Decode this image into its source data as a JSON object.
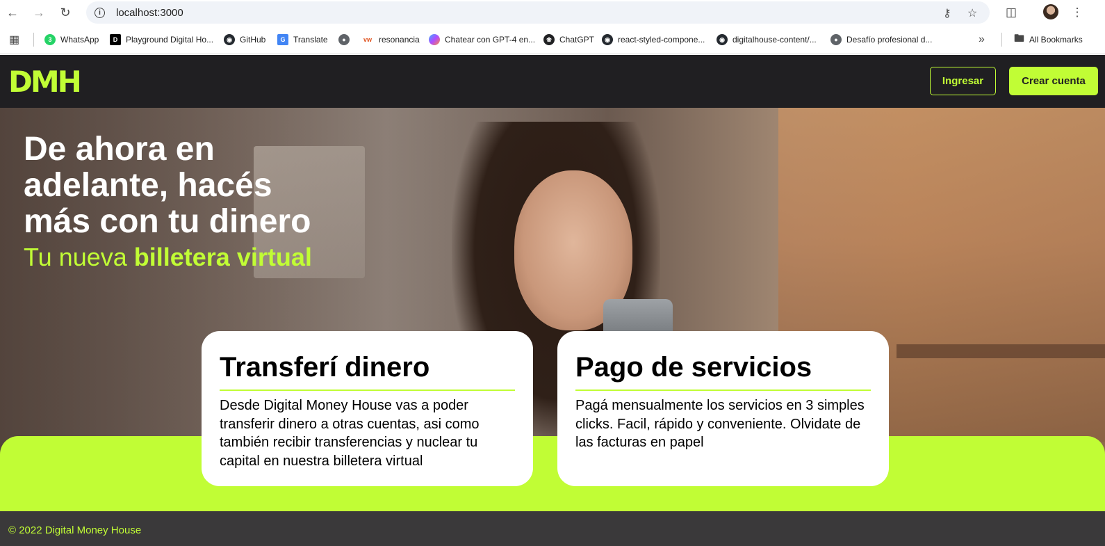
{
  "browser": {
    "url": "localhost:3000",
    "bookmarks": [
      {
        "label": "WhatsApp",
        "icon": "whatsapp-icon",
        "color": "#25d366"
      },
      {
        "label": "Playground Digital Ho...",
        "icon": "digital-house-icon",
        "color": "#000000"
      },
      {
        "label": "GitHub",
        "icon": "github-icon",
        "color": "#24292f"
      },
      {
        "label": "Translate",
        "icon": "google-translate-icon",
        "color": "#4285f4"
      },
      {
        "label": "",
        "icon": "globe-icon",
        "color": "#5f6368"
      },
      {
        "label": "resonancia",
        "icon": "resonancia-icon",
        "color": "#e0531f"
      },
      {
        "label": "Chatear con GPT-4 en...",
        "icon": "copilot-icon",
        "color": "#8a5cf6"
      },
      {
        "label": "ChatGPT",
        "icon": "openai-icon",
        "color": "#202123"
      },
      {
        "label": "react-styled-compone...",
        "icon": "github-icon",
        "color": "#24292f"
      },
      {
        "label": "digitalhouse-content/...",
        "icon": "github-icon",
        "color": "#24292f"
      },
      {
        "label": "Desafío profesional d...",
        "icon": "globe-icon",
        "color": "#5f6368"
      }
    ],
    "overflow_label": "»",
    "all_bookmarks_label": "All Bookmarks"
  },
  "header": {
    "logo_text": "DMH",
    "login_label": "Ingresar",
    "signup_label": "Crear cuenta"
  },
  "hero": {
    "title": "De ahora en adelante, hacés más con tu dinero",
    "subtitle_prefix": "Tu nueva ",
    "subtitle_bold": "billetera virtual"
  },
  "cards": [
    {
      "title": "Transferí dinero",
      "body": "Desde Digital Money House vas a poder transferir dinero a otras cuentas, asi como también recibir transferencias y nuclear tu capital en nuestra billetera virtual"
    },
    {
      "title": "Pago de servicios",
      "body": "Pagá mensualmente los servicios en 3 simples clicks. Facil, rápido y conveniente. Olvidate de las facturas en papel"
    }
  ],
  "footer": {
    "copyright": "© 2022 Digital Money House"
  },
  "colors": {
    "accent": "#c1fd35",
    "dark": "#201f22",
    "footer_bg": "#3a393a"
  }
}
